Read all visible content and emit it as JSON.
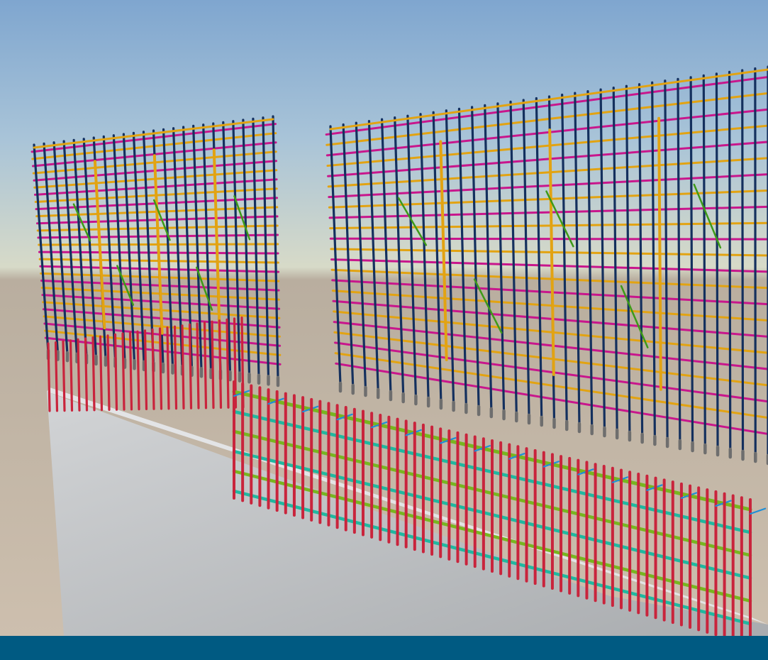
{
  "scene": {
    "subject": "rebar-cage-3d-render",
    "colors": {
      "sky_top": "#7fa6cf",
      "sky_mid": "#a9c4d8",
      "horizon": "#d7dac8",
      "ground_top": "#b9ae9f",
      "ground_bottom": "#cdbfae",
      "concrete_light": "#d2d4d6",
      "concrete_dark": "#a9acaf",
      "rebar_vertical_navy": "#14305e",
      "rebar_horizontal_magenta": "#c8168c",
      "rebar_horizontal_orange": "#e2a312",
      "rebar_tie_green": "#3d9a18",
      "rebar_starter_red": "#c9243c",
      "rebar_beam_lime": "#78b51f",
      "rebar_beam_teal": "#1fb8a0",
      "rebar_stirrup_blue": "#1e8fd8",
      "coupler_grey": "#6e6e6e"
    }
  },
  "footer": {
    "color": "#005a82"
  }
}
